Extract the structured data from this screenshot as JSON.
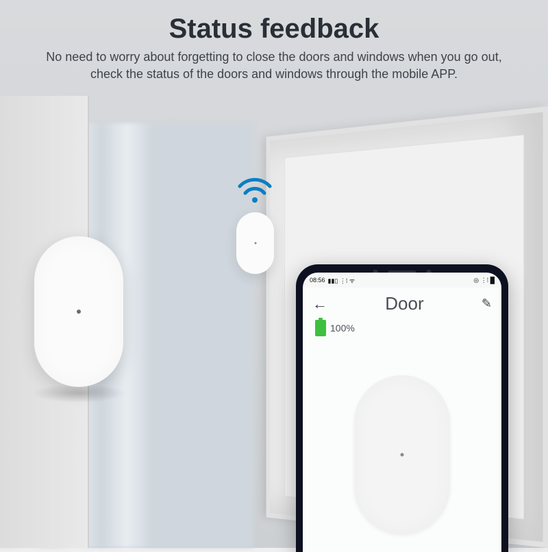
{
  "heading": {
    "title": "Status feedback",
    "subtitle": "No need to worry about forgetting to close the doors and windows when you go out, check the status of the doors and windows through the mobile APP."
  },
  "wifi": {
    "color": "#0a7fc2"
  },
  "phone": {
    "statusbar": {
      "time": "08:56"
    },
    "app": {
      "title": "Door",
      "battery": "100%"
    }
  }
}
